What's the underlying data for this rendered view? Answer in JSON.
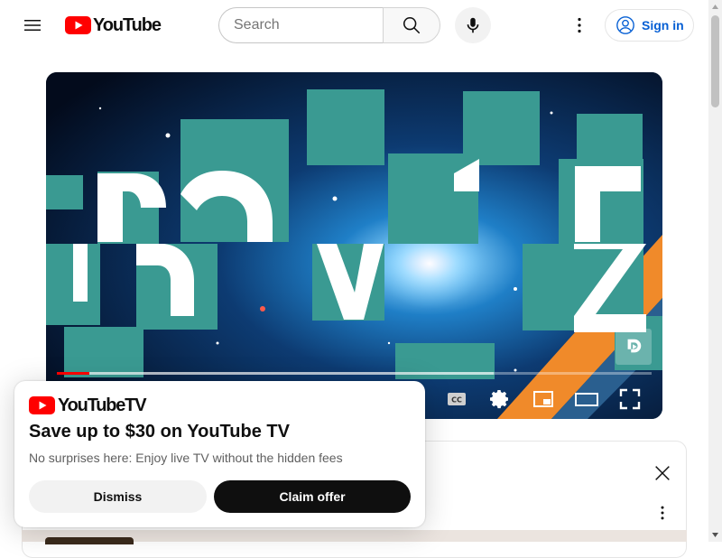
{
  "masthead": {
    "logo_text": "YouTube",
    "search_placeholder": "Search",
    "signin_label": "Sign in"
  },
  "player": {
    "progress_played": 0.055,
    "progress_loaded": 0.735,
    "controls": [
      "subtitles-icon",
      "settings-icon",
      "miniplayer-icon",
      "theater-mode-icon",
      "fullscreen-icon"
    ]
  },
  "promo": {
    "logo_text": "YouTubeTV",
    "title": "Save up to $30 on YouTube TV",
    "subtitle": "No surprises here: Enjoy live TV without the hidden fees",
    "dismiss_label": "Dismiss",
    "claim_label": "Claim offer"
  },
  "colors": {
    "brand_red": "#ff0000",
    "link_blue": "#065fd4",
    "teal_tile": "#3a9a92"
  }
}
